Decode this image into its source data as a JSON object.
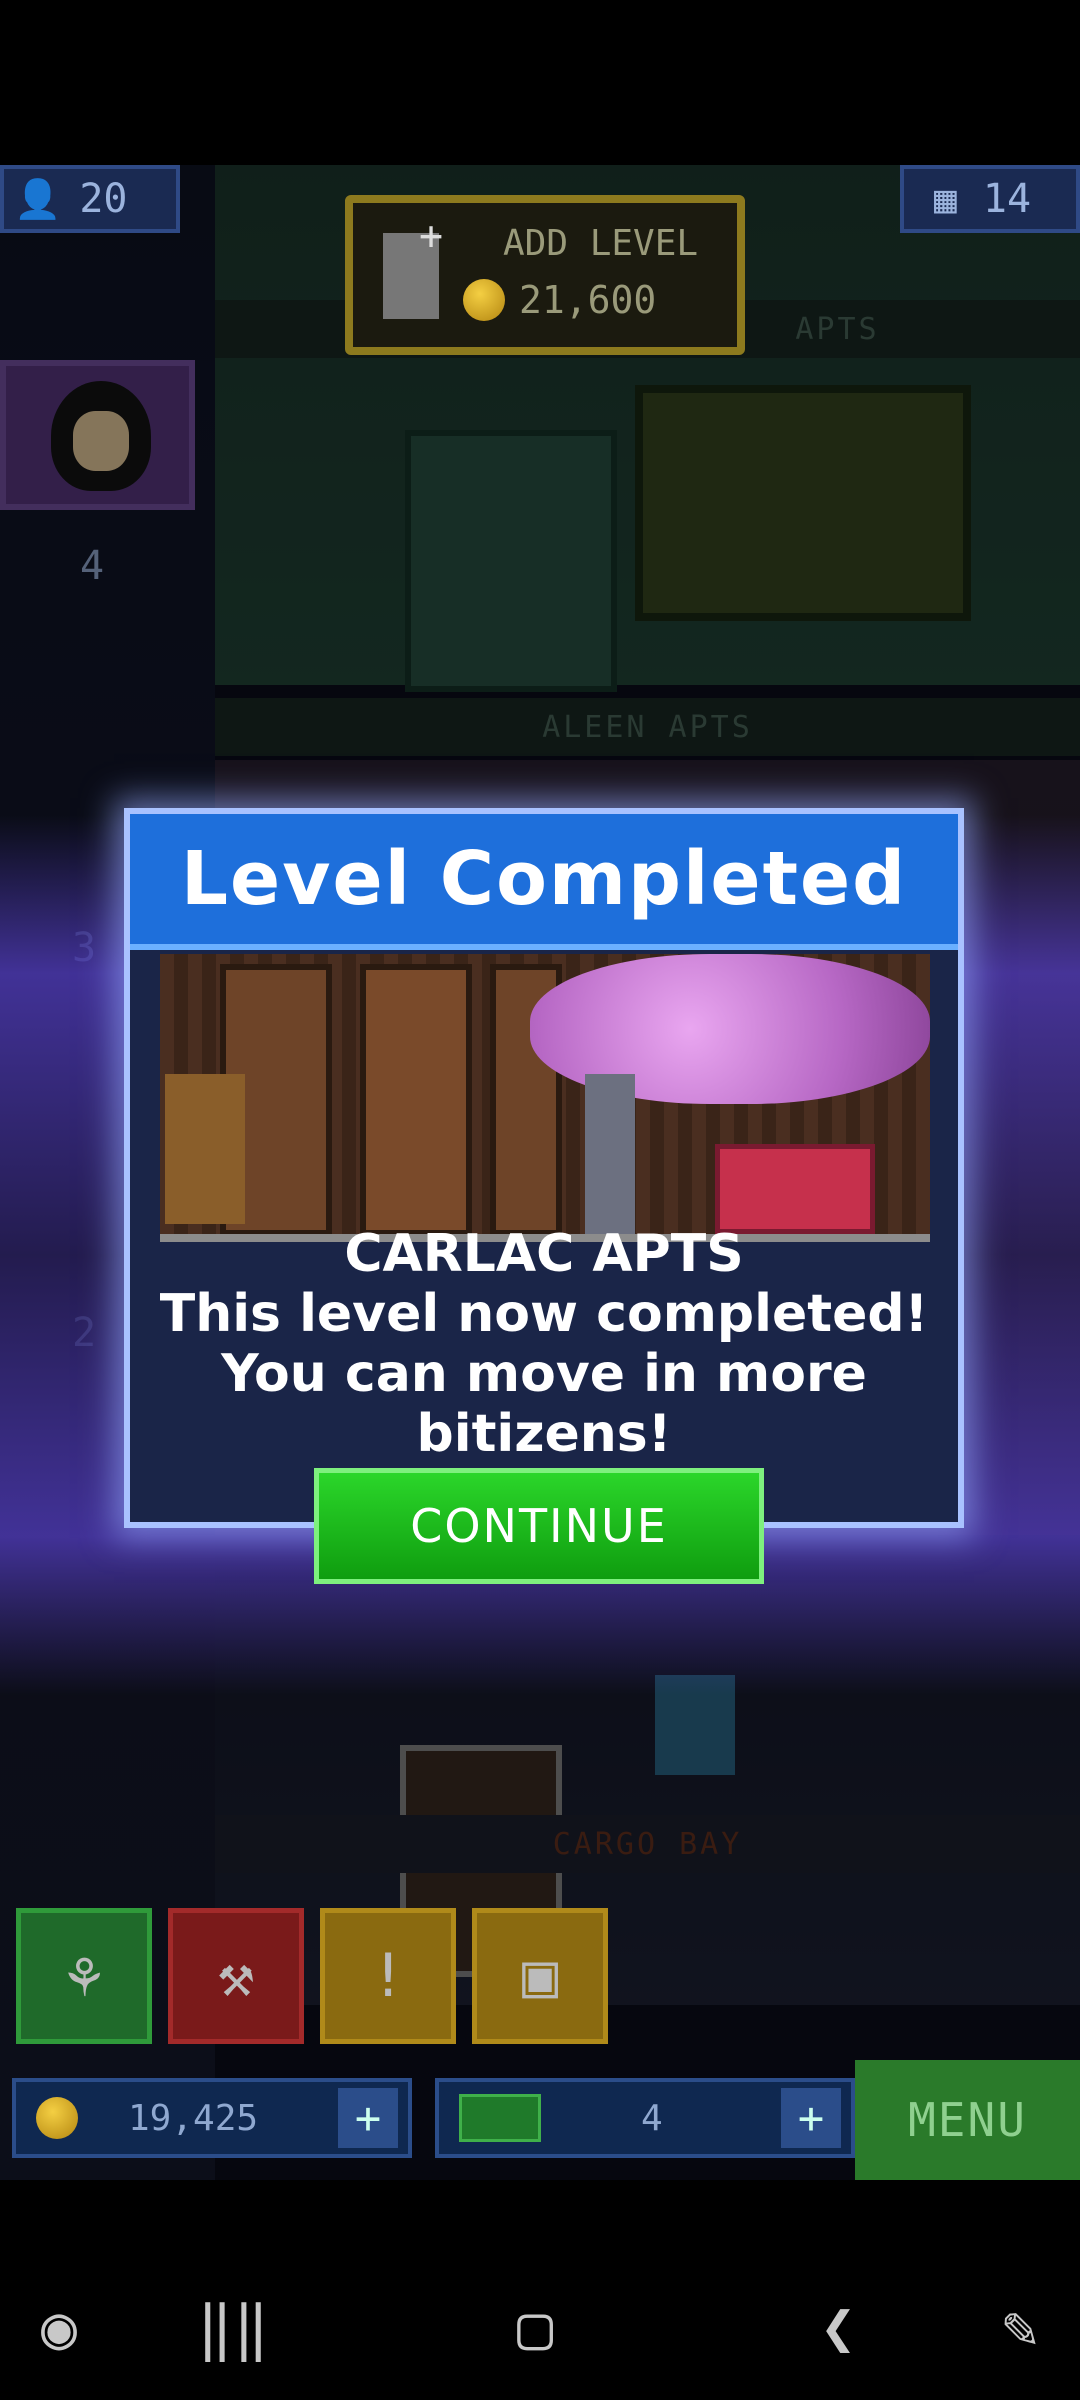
{
  "hud": {
    "population": "20",
    "floors": "14",
    "add_level_label": "ADD LEVEL",
    "add_level_cost": "21,600",
    "elevator_floor_number": "4",
    "shaft_numbers": [
      "3",
      "2"
    ]
  },
  "floors": {
    "upper_floor_name": "APTS",
    "aleen_floor_name": "ALEEN APTS",
    "cargo_floor_name": "CARGO BAY"
  },
  "dialog": {
    "title": "Level Completed",
    "floor_name": "CARLAC APTS",
    "message_line1": "This level now completed!",
    "message_line2": "You can move in more",
    "message_line3": "bitizens!",
    "continue_label": "CONTINUE"
  },
  "bottom": {
    "coins": "19,425",
    "bux": "4",
    "menu_label": "MENU",
    "plus_label": "+"
  },
  "colors": {
    "dialog_header": "#1e6fdb",
    "continue_green": "#1fc21f",
    "coin_gold": "#e0b12a",
    "glow_purple": "#6e50ff"
  },
  "icons": {
    "population": "person-icon",
    "floors": "building-icon",
    "add_level": "add-document-icon",
    "tools": [
      "alien-icon",
      "hammer-icon",
      "exclamation-icon",
      "box-icon"
    ],
    "nav": [
      "game-controller-icon",
      "recents-icon",
      "home-icon",
      "back-icon",
      "screenshot-icon"
    ]
  }
}
